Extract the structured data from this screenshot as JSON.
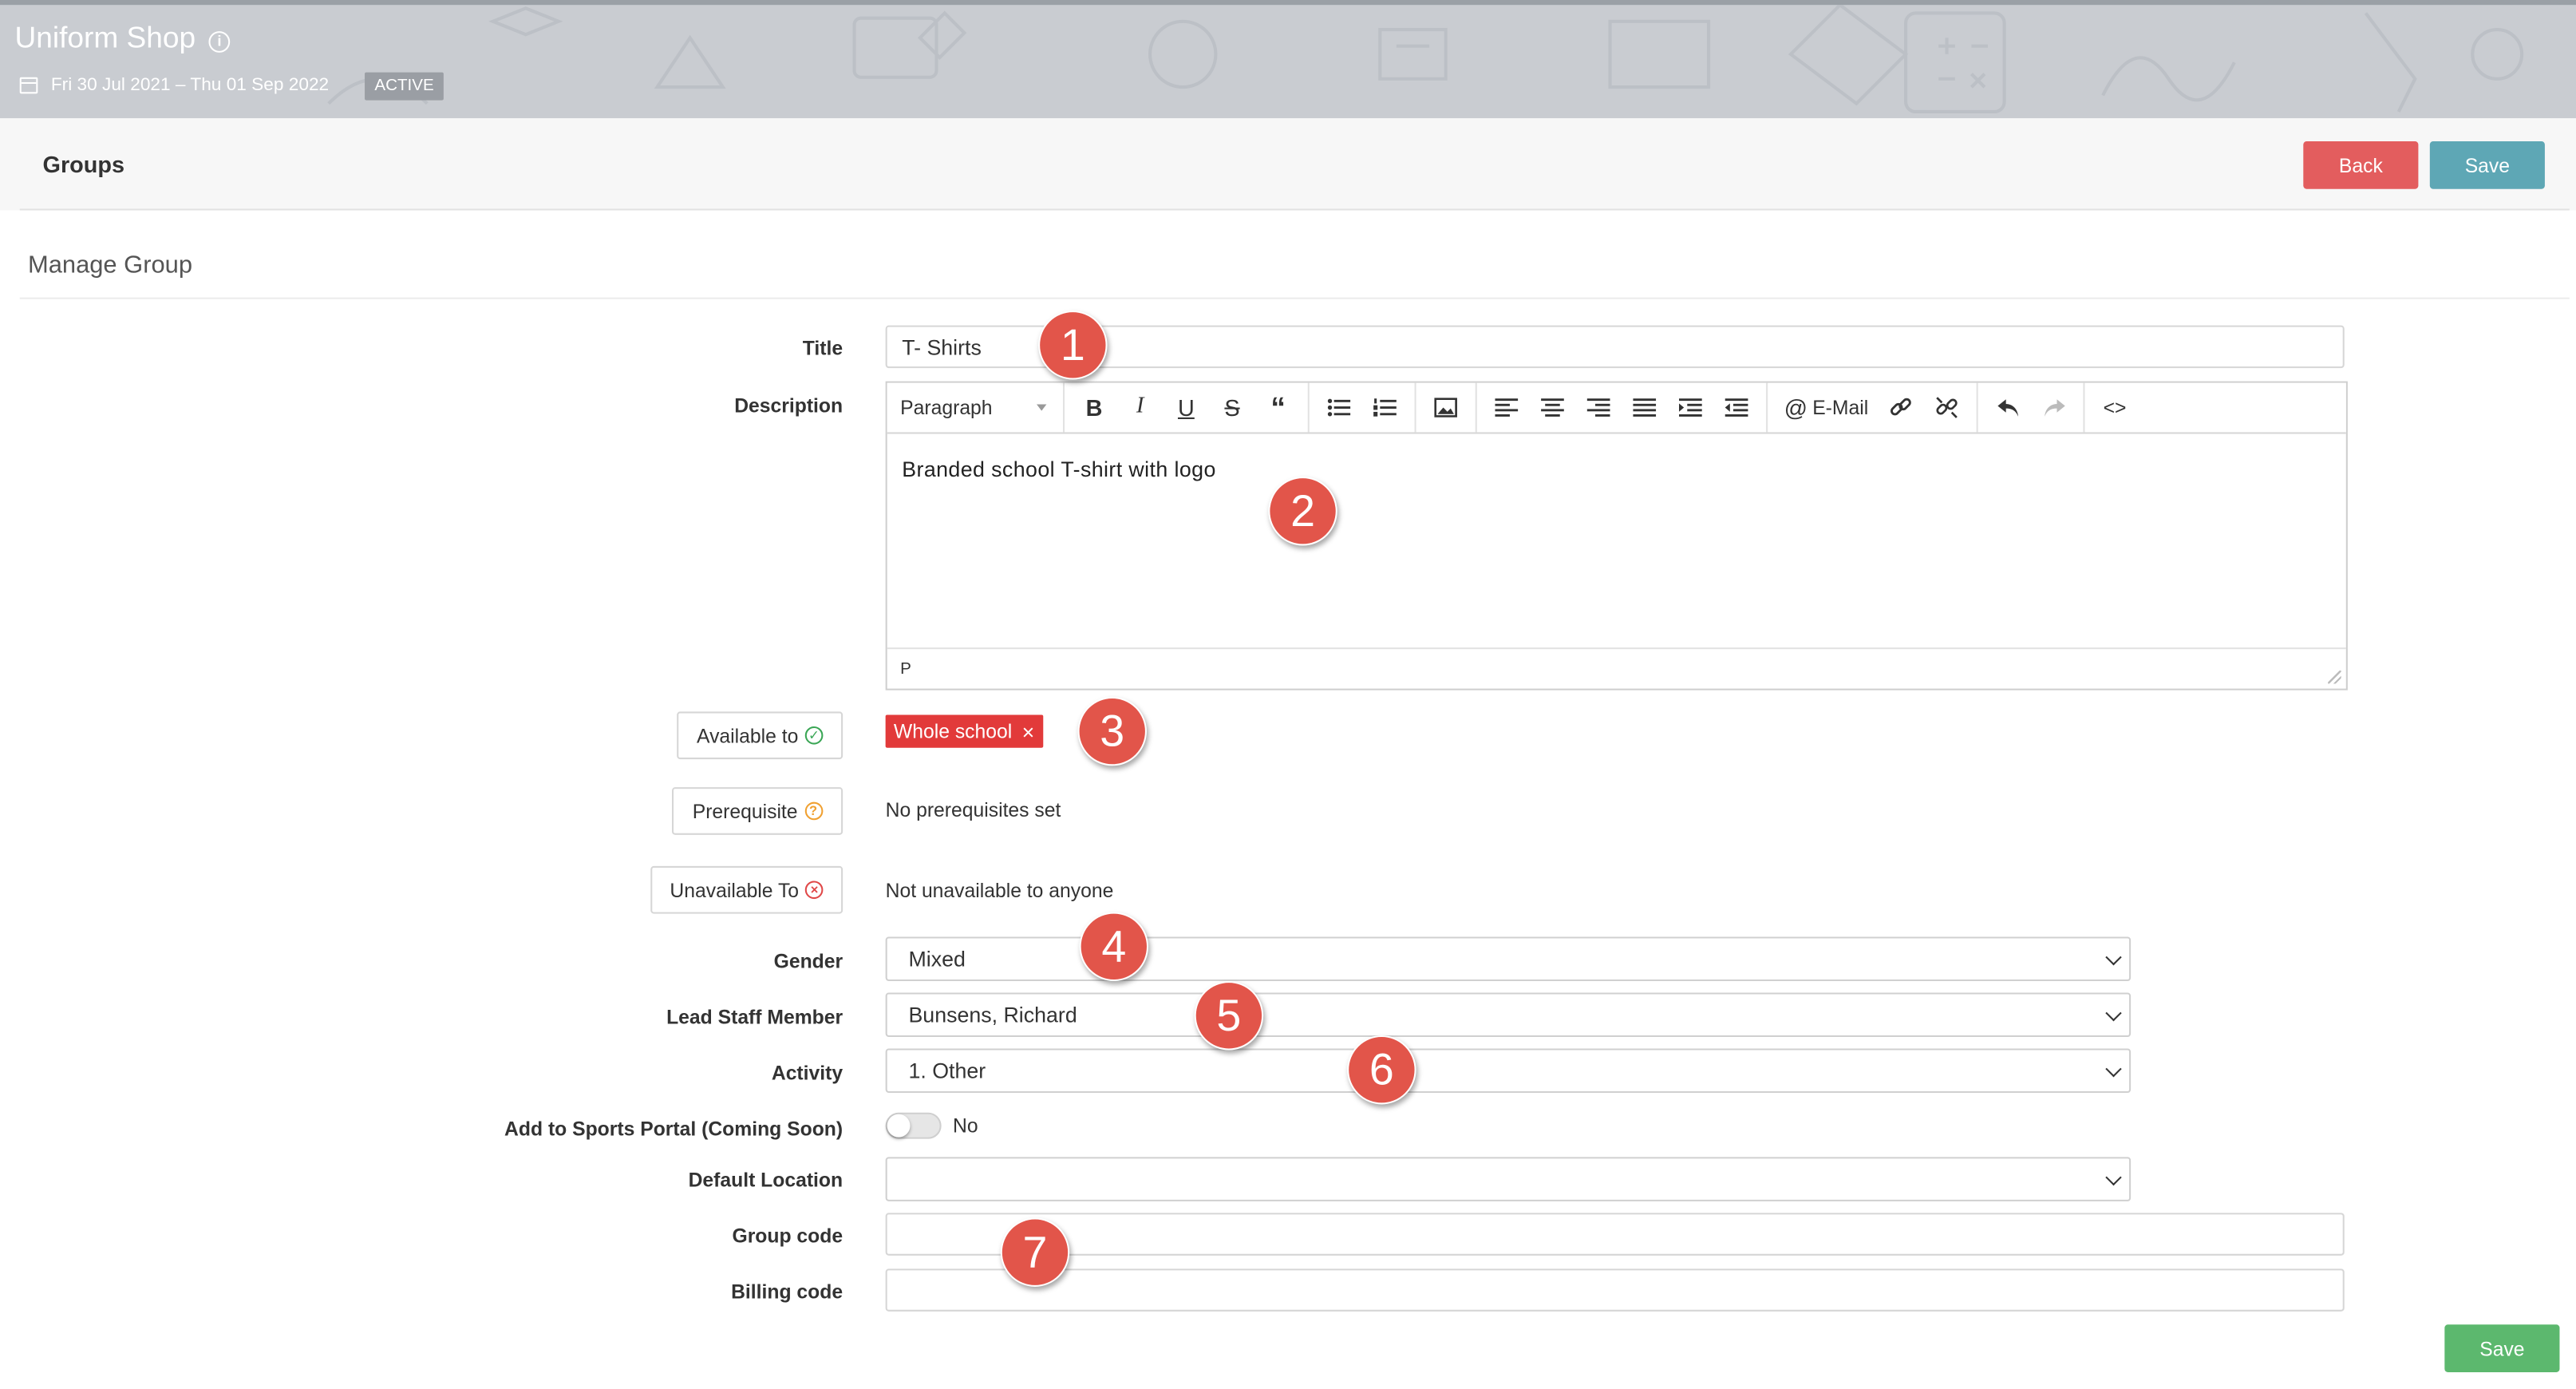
{
  "header": {
    "title": "Uniform Shop",
    "date_range": "Fri 30 Jul 2021 – Thu 01 Sep 2022",
    "status_badge": "ACTIVE"
  },
  "bar": {
    "heading": "Groups",
    "back_label": "Back",
    "save_label": "Save"
  },
  "section_title": "Manage Group",
  "form": {
    "title_label": "Title",
    "title_value": "T- Shirts",
    "description_label": "Description",
    "editor": {
      "format_select": "Paragraph",
      "email_label": "E-Mail",
      "body_text": "Branded school T-shirt with logo",
      "status_path": "P"
    },
    "available_to_label": "Available to",
    "available_tag": "Whole school",
    "prerequisite_label": "Prerequisite",
    "prerequisite_value": "No prerequisites set",
    "unavailable_label": "Unavailable To",
    "unavailable_value": "Not unavailable to anyone",
    "gender_label": "Gender",
    "gender_value": "Mixed",
    "lead_staff_label": "Lead Staff Member",
    "lead_staff_value": "Bunsens, Richard",
    "activity_label": "Activity",
    "activity_value": "1. Other",
    "sports_portal_label": "Add to Sports Portal (Coming Soon)",
    "sports_portal_value": "No",
    "default_location_label": "Default Location",
    "default_location_value": "",
    "group_code_label": "Group code",
    "group_code_value": "",
    "billing_code_label": "Billing code",
    "billing_code_value": ""
  },
  "footer": {
    "save_label": "Save"
  },
  "markers": [
    "1",
    "2",
    "3",
    "4",
    "5",
    "6",
    "7"
  ],
  "colors": {
    "back": "#e35d5e",
    "save_top": "#5ea7b5",
    "save_bottom": "#5cb86e",
    "tag": "#e23a3a",
    "marker": "#e2554a"
  }
}
